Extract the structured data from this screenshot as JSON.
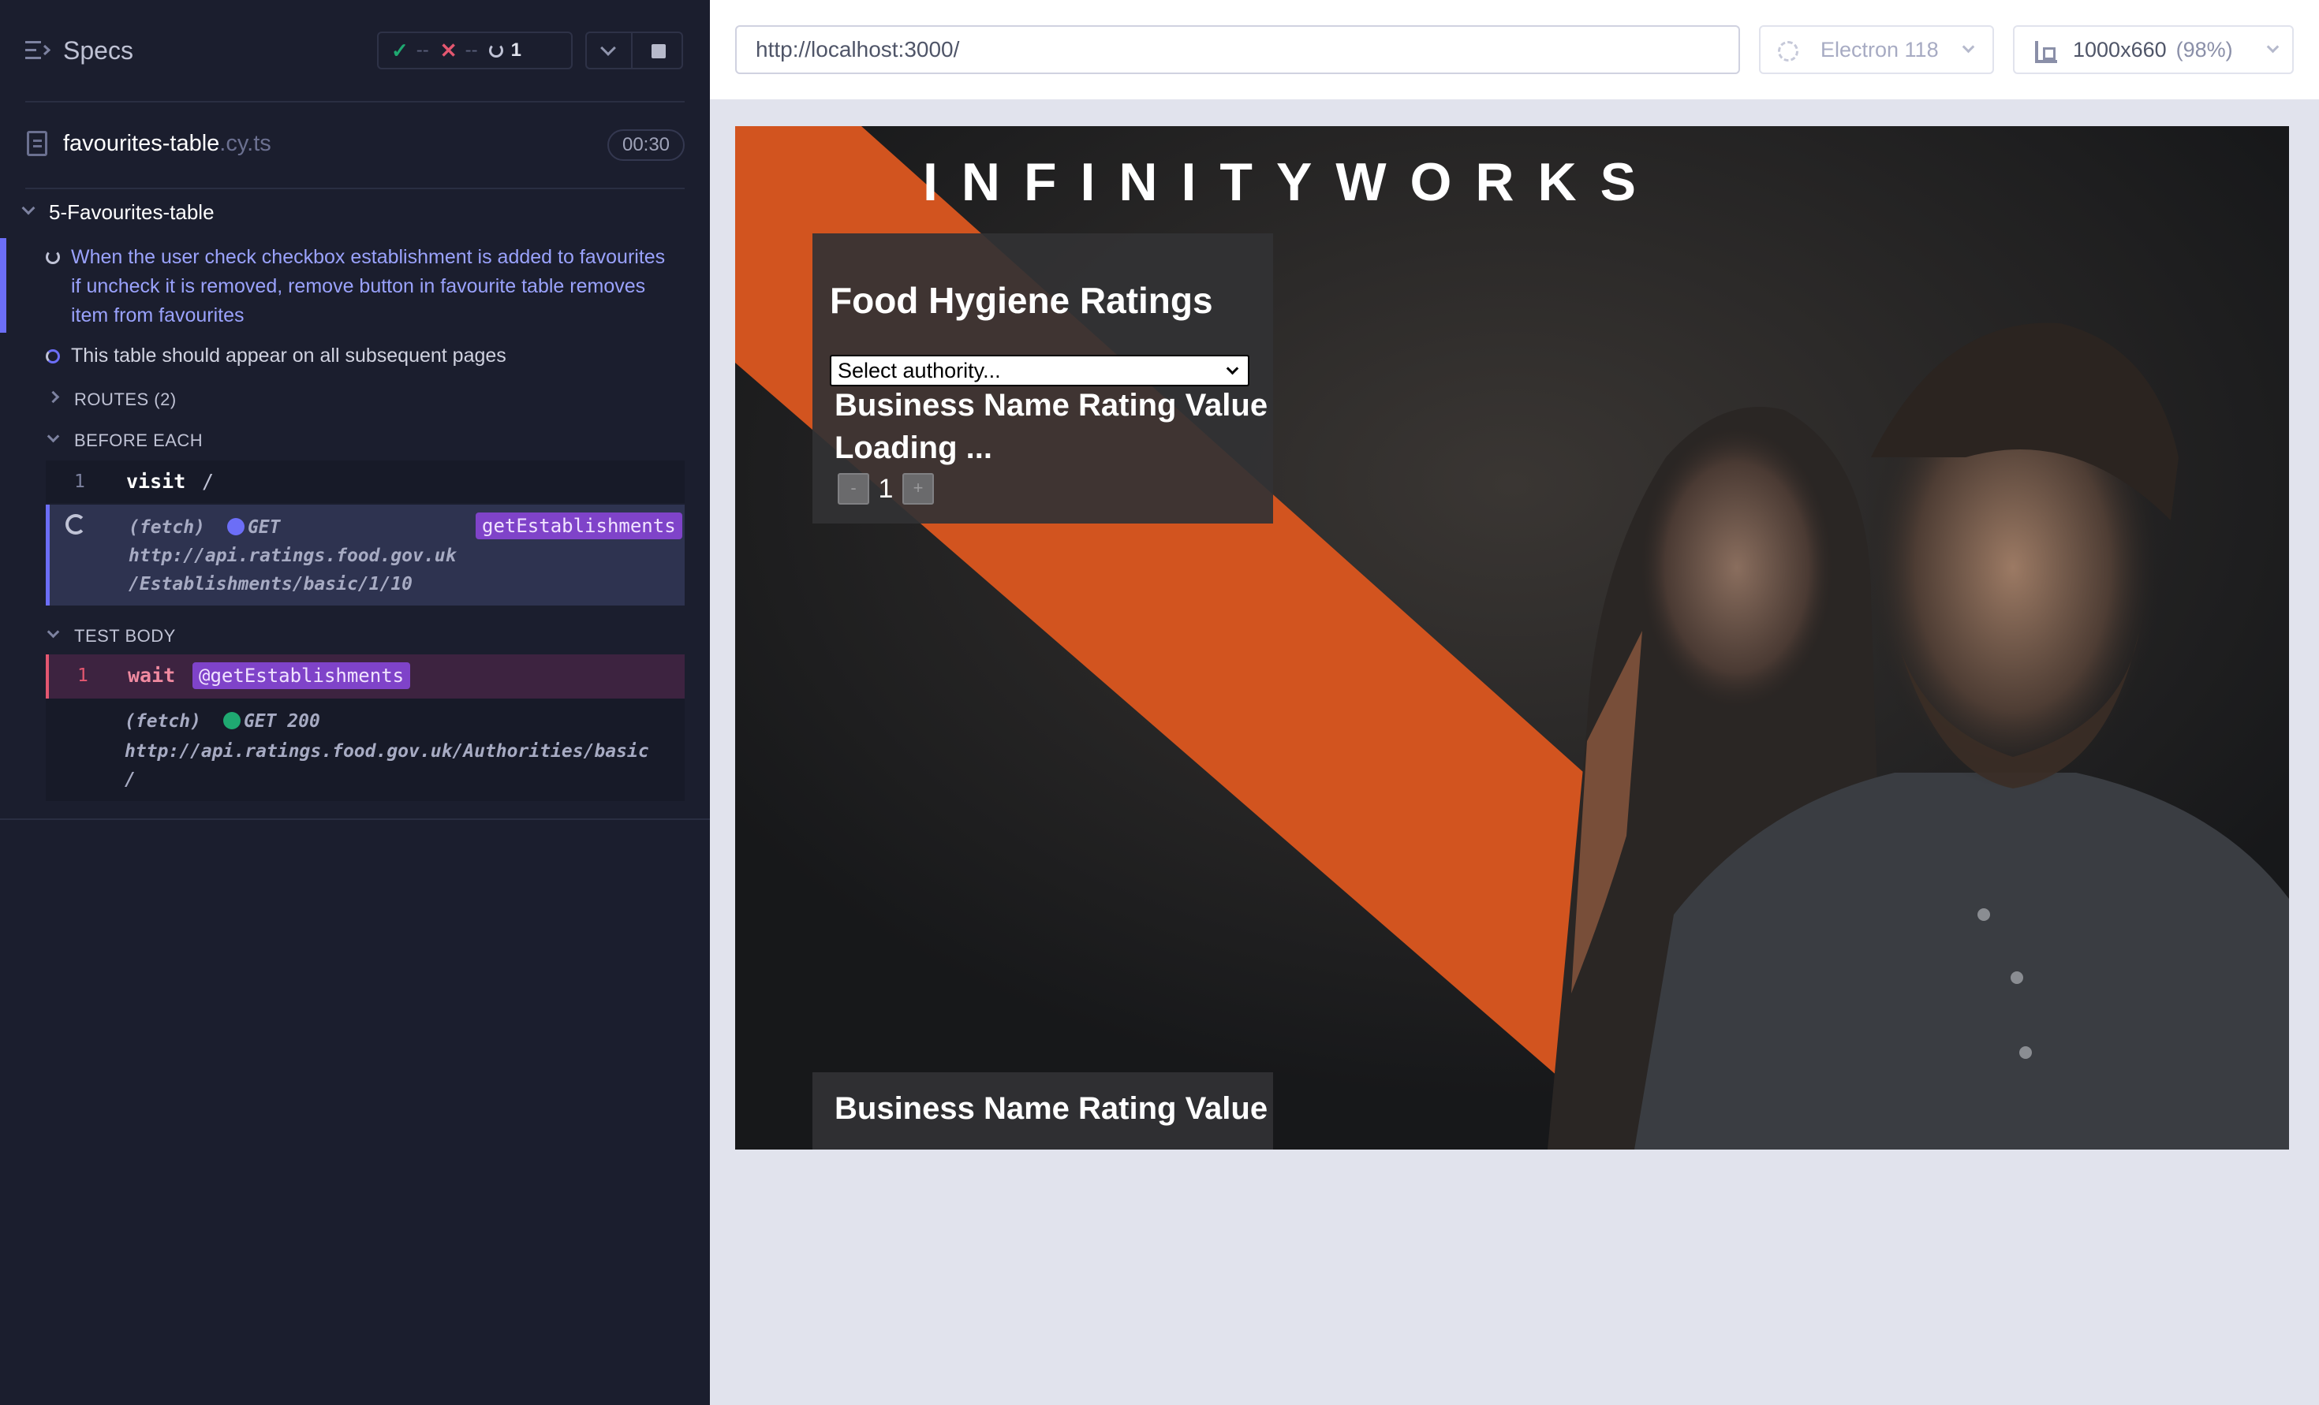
{
  "reporter": {
    "specs_label": "Specs",
    "stats": {
      "passed": "--",
      "failed": "--",
      "pending": "1"
    },
    "file": {
      "name": "favourites-table",
      "ext": ".cy.ts",
      "duration": "00:30"
    },
    "suite": {
      "title": "5-Favourites-table"
    },
    "tests": [
      {
        "title": "When the user check checkbox establishment is added to favourites if uncheck it is removed, remove button in favourite table removes item from favourites",
        "state": "running"
      },
      {
        "title": "This table should appear on all subsequent pages",
        "state": "pending"
      }
    ],
    "hooks": {
      "routes": "ROUTES (2)",
      "before_each": "BEFORE EACH",
      "test_body": "TEST BODY"
    },
    "commands": {
      "visit": {
        "num": "1",
        "name": "visit",
        "msg": "/"
      },
      "fetch1": {
        "prefix": "(fetch)",
        "method": "GET",
        "url_line1": "http://api.ratings.food.gov.uk",
        "url_line2": "/Establishments/basic/1/10",
        "alias": "getEstablishments"
      },
      "wait": {
        "num": "1",
        "name": "wait",
        "alias": "@getEstablishments"
      },
      "fetch2": {
        "prefix": "(fetch)",
        "method": "GET 200",
        "url_line1": "http://api.ratings.food.gov.uk/Authorities/basic",
        "url_line2": "/"
      }
    }
  },
  "aut": {
    "url": "http://localhost:3000/",
    "browser": "Electron 118",
    "viewport": "1000x660",
    "zoom": "(98%)",
    "app": {
      "logo": "INFINITYWORKS",
      "title": "Food Hygiene Ratings",
      "select_placeholder": "Select authority...",
      "table_header": "Business Name Rating Value",
      "loading": "Loading ...",
      "pager": {
        "prev": "-",
        "page": "1",
        "next": "+"
      },
      "favourites_header": "Business Name Rating Value"
    }
  },
  "colors": {
    "accent": "#6c6ef7",
    "brand_orange": "#d4541f",
    "pass": "#1fa971",
    "fail": "#e45770",
    "alias": "#7f43c9"
  }
}
